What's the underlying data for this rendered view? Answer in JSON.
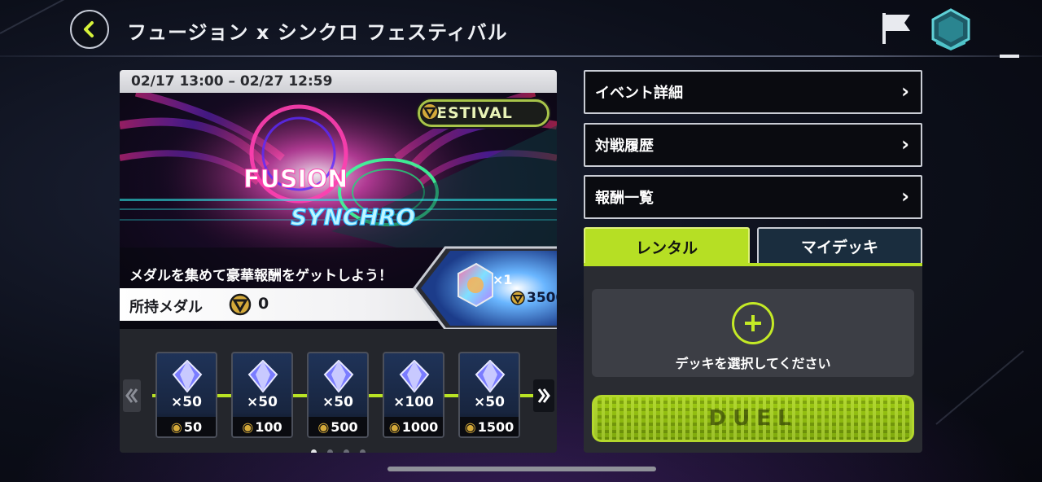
{
  "header": {
    "title": "フュージョン x シンクロ フェスティバル"
  },
  "event": {
    "date_range": "02/17 13:00 – 02/27 12:59",
    "badge": "FESTIVAL",
    "banner_title_1": "FUSION",
    "banner_title_2": "SYNCHRO",
    "slogan": "メダルを集めて豪華報酬をゲットしよう！",
    "medal_label": "所持メダル",
    "medal_count": "0",
    "featured_reward": {
      "qty": "×1",
      "price": "3500"
    }
  },
  "rewards": [
    {
      "qty": "×50",
      "cost": "50"
    },
    {
      "qty": "×50",
      "cost": "100"
    },
    {
      "qty": "×50",
      "cost": "500"
    },
    {
      "qty": "×100",
      "cost": "1000"
    },
    {
      "qty": "×50",
      "cost": "1500"
    }
  ],
  "pager": {
    "pages": 4,
    "active": 0
  },
  "menu": {
    "event_details": "イベント詳細",
    "battle_history": "対戦履歴",
    "reward_list": "報酬一覧"
  },
  "tabs": {
    "rental": "レンタル",
    "my_deck": "マイデッキ",
    "active": "rental"
  },
  "deck": {
    "hint": "デッキを選択してください",
    "duel_label": "DUEL"
  },
  "colors": {
    "accent": "#b6df24",
    "panel": "#27292f",
    "menu_bg": "#0a0b10"
  }
}
